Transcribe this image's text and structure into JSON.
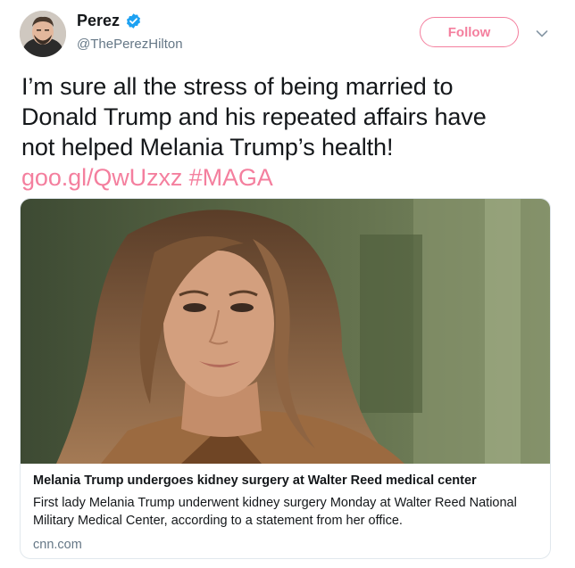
{
  "header": {
    "display_name": "Perez",
    "handle": "@ThePerezHilton",
    "follow_label": "Follow"
  },
  "tweet": {
    "lines": [
      "I’m sure all the stress of being married to",
      "Donald Trump and his repeated affairs have",
      "not helped Melania Trump’s health!"
    ],
    "link_url": "goo.gl/QwUzxz",
    "hashtag": "#MAGA"
  },
  "card": {
    "title": "Melania Trump undergoes kidney surgery at Walter Reed medical center",
    "description": "First lady Melania Trump underwent kidney surgery Monday at Walter Reed National Military Medical Center, according to a statement from her office.",
    "domain": "cnn.com"
  },
  "icons": {
    "verified": "verified-badge-icon",
    "caret": "chevron-down-icon"
  },
  "colors": {
    "accent": "#f47f9e",
    "verified": "#1da1f2",
    "text": "#14171a",
    "secondary": "#657786"
  }
}
